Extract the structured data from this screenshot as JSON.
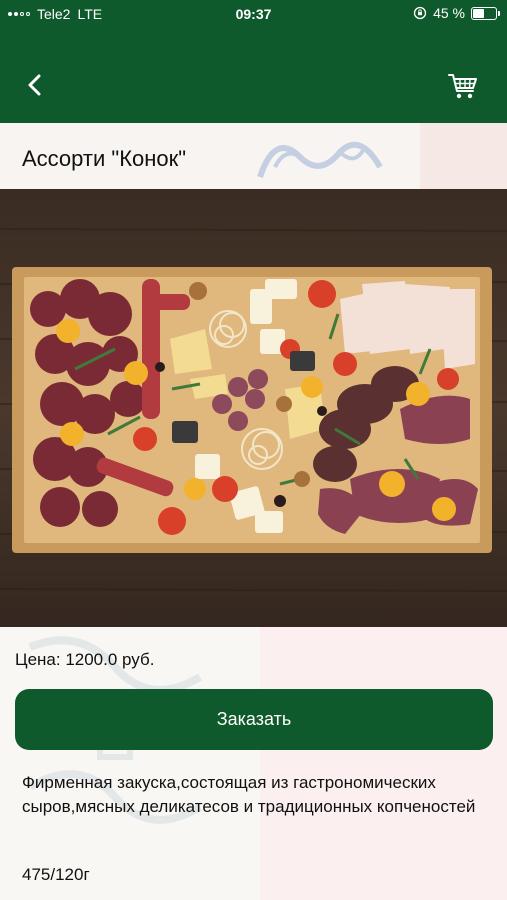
{
  "status_bar": {
    "carrier": "Tele2",
    "network": "LTE",
    "time": "09:37",
    "battery": "45 %",
    "battery_level": 0.45
  },
  "nav": {
    "back_icon": "chevron-left-icon",
    "cart_icon": "shopping-cart-icon"
  },
  "product": {
    "title": "Ассорти \"Конок\"",
    "image": "food-photo",
    "price": "Цена: 1200.0 руб.",
    "order_label": "Заказать",
    "description": "Фирменная закуска,состоящая из гастрономических сыров,мясных деликатесов и традиционных копченостей",
    "weight": "475/120г"
  },
  "colors": {
    "brand_green": "#0f5a2c",
    "background": "#ffffff",
    "button_text": "#ffffff"
  }
}
